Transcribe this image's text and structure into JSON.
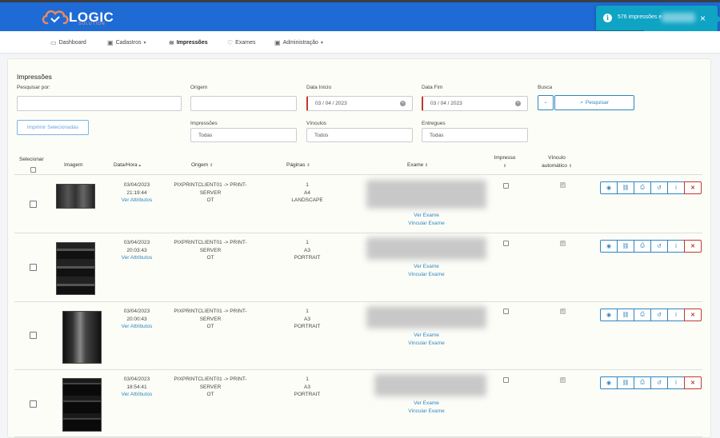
{
  "brand": {
    "name": "LOGIC",
    "sub": "SOLUTION"
  },
  "toast": {
    "text": "576 impressões e"
  },
  "nav": [
    {
      "label": "Dashboard",
      "icon": "chat-icon"
    },
    {
      "label": "Cadastros",
      "icon": "briefcase-icon"
    },
    {
      "label": "Impressões",
      "icon": "layers-icon"
    },
    {
      "label": "Exames",
      "icon": "heart-icon"
    },
    {
      "label": "Administração",
      "icon": "briefcase-icon"
    }
  ],
  "page": {
    "title": "Impressões"
  },
  "filters": {
    "pesquisar_por": {
      "label": "Pesquisar por:",
      "value": ""
    },
    "origem": {
      "label": "Origem",
      "value": ""
    },
    "data_inicio": {
      "label": "Data Início",
      "value": "03 / 04 / 2023"
    },
    "data_fim": {
      "label": "Data Fim",
      "value": "03 / 04 / 2023"
    },
    "busca": {
      "label": "Busca",
      "button": "Pesquisar"
    },
    "impressoes": {
      "label": "Impressões",
      "value": "Todas"
    },
    "vinculos": {
      "label": "Vínculos",
      "value": "Todos"
    },
    "entregues": {
      "label": "Entregues",
      "value": "Todas"
    },
    "print_selected": "Imprimir Selecionadas"
  },
  "columns": {
    "selecionar": "Selecionar",
    "imagem": "Imagem",
    "data_hora": "Data/Hora",
    "origem": "Origem",
    "paginas": "Páginas",
    "exame": "Exame",
    "impresso": "Impresso",
    "vinculo_1": "Vínculo",
    "vinculo_2": "automático"
  },
  "rows": [
    {
      "date": "03/04/2023",
      "time": "21:19:44",
      "attrs": "Ver Attributos",
      "origin_1": "PIXPRINTCLIENT01 -> PRINT-",
      "origin_2": "SERVER",
      "origin_3": "OT",
      "pages": "1",
      "size": "A4",
      "orient": "LANDSCAPE",
      "ver_exame": "Ver Exame",
      "vincular": "Vincular Exame"
    },
    {
      "date": "03/04/2023",
      "time": "20:03:43",
      "attrs": "Ver Attributos",
      "origin_1": "PIXPRINTCLIENT01 -> PRINT-",
      "origin_2": "SERVER",
      "origin_3": "OT",
      "pages": "1",
      "size": "A3",
      "orient": "PORTRAIT",
      "ver_exame": "Ver Exame",
      "vincular": "Vincular Exame"
    },
    {
      "date": "03/04/2023",
      "time": "20:00:43",
      "attrs": "Ver Attributos",
      "origin_1": "PIXPRINTCLIENT01 -> PRINT-",
      "origin_2": "SERVER",
      "origin_3": "OT",
      "pages": "1",
      "size": "A3",
      "orient": "PORTRAIT",
      "ver_exame": "Ver Exame",
      "vincular": "Vincular Exame"
    },
    {
      "date": "03/04/2023",
      "time": "18:54:41",
      "attrs": "Ver Attributos",
      "origin_1": "PIXPRINTCLIENT01 -> PRINT-",
      "origin_2": "SERVER",
      "origin_3": "OT",
      "pages": "1",
      "size": "A3",
      "orient": "PORTRAIT",
      "ver_exame": "Ver Exame",
      "vincular": "Vincular Exame"
    }
  ],
  "row_actions": [
    "eye-icon",
    "link-icon",
    "printer-icon",
    "history-icon",
    "info-icon",
    "close-icon"
  ],
  "colors": {
    "primary": "#1f6bd6",
    "accent": "#2e86c1",
    "danger": "#c0392b",
    "toast": "#0fa3c4"
  }
}
